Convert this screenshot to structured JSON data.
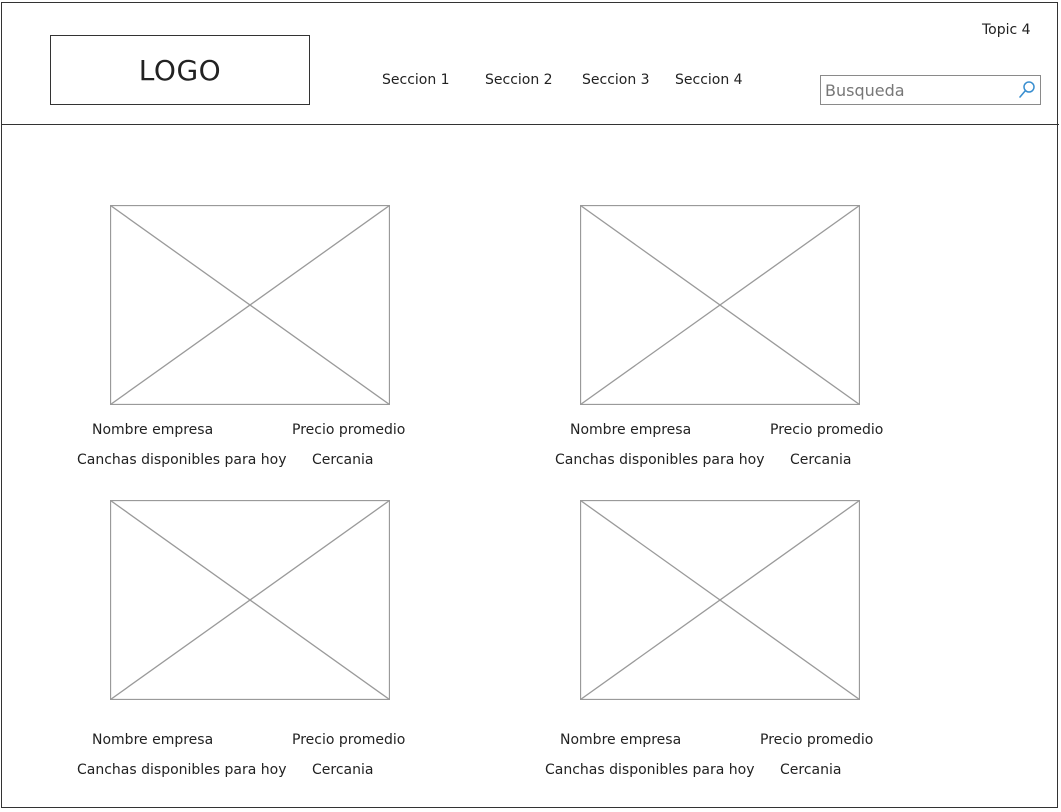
{
  "header": {
    "logo": "LOGO",
    "topic": "Topic 4",
    "nav": [
      "Seccion 1",
      "Seccion 2",
      "Seccion 3",
      "Seccion 4"
    ],
    "search_placeholder": "Busqueda"
  },
  "cards": [
    {
      "name": "Nombre empresa",
      "price": "Precio promedio",
      "courts": "Canchas disponibles para hoy",
      "distance": "Cercania"
    },
    {
      "name": "Nombre empresa",
      "price": "Precio promedio",
      "courts": "Canchas disponibles para hoy",
      "distance": "Cercania"
    },
    {
      "name": "Nombre empresa",
      "price": "Precio promedio",
      "courts": "Canchas disponibles para hoy",
      "distance": "Cercania"
    },
    {
      "name": "Nombre empresa",
      "price": "Precio promedio",
      "courts": "Canchas disponibles para hoy",
      "distance": "Cercania"
    }
  ],
  "colors": {
    "border": "#333333",
    "placeholder_stroke": "#9a9a9a",
    "search_icon": "#3a8fd0"
  }
}
